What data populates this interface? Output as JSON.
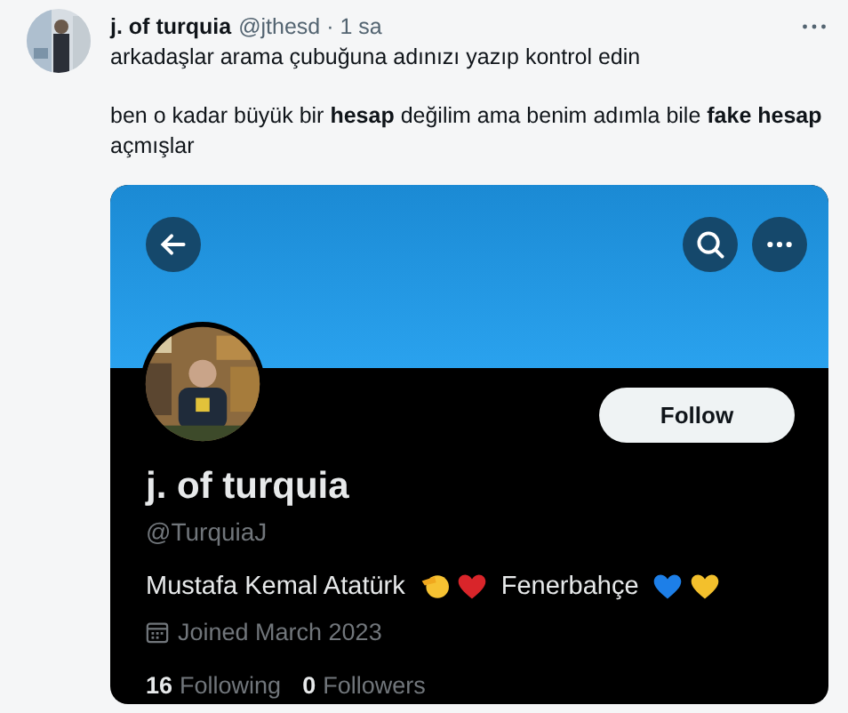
{
  "tweet": {
    "author_name": "j. of turquia",
    "meta": "@jthesd · 1 sa",
    "paragraphs": [
      "arkadaşlar arama çubuğuna adınızı yazıp kontrol edin",
      "ben o kadar büyük bir **hesap** değilim ama benim adımla bile **fake hesap** açmışlar"
    ],
    "image": {
      "follow_button": "Follow",
      "name": "j. of turquia",
      "handle": "@TurquiaJ",
      "bio": [
        {
          "kind": "text",
          "text": "Mustafa Kemal Atatürk"
        },
        {
          "kind": "salute"
        },
        {
          "kind": "heart",
          "color": "#d9252a"
        },
        {
          "kind": "text",
          "text": "Fenerbahçe"
        },
        {
          "kind": "heart",
          "color": "#1d7fe8"
        },
        {
          "kind": "heart",
          "color": "#f3c02c"
        }
      ],
      "joined": "Joined March 2023",
      "stats": [
        {
          "count": "16",
          "label": "Following"
        },
        {
          "count": "0",
          "label": "Followers"
        }
      ]
    }
  }
}
